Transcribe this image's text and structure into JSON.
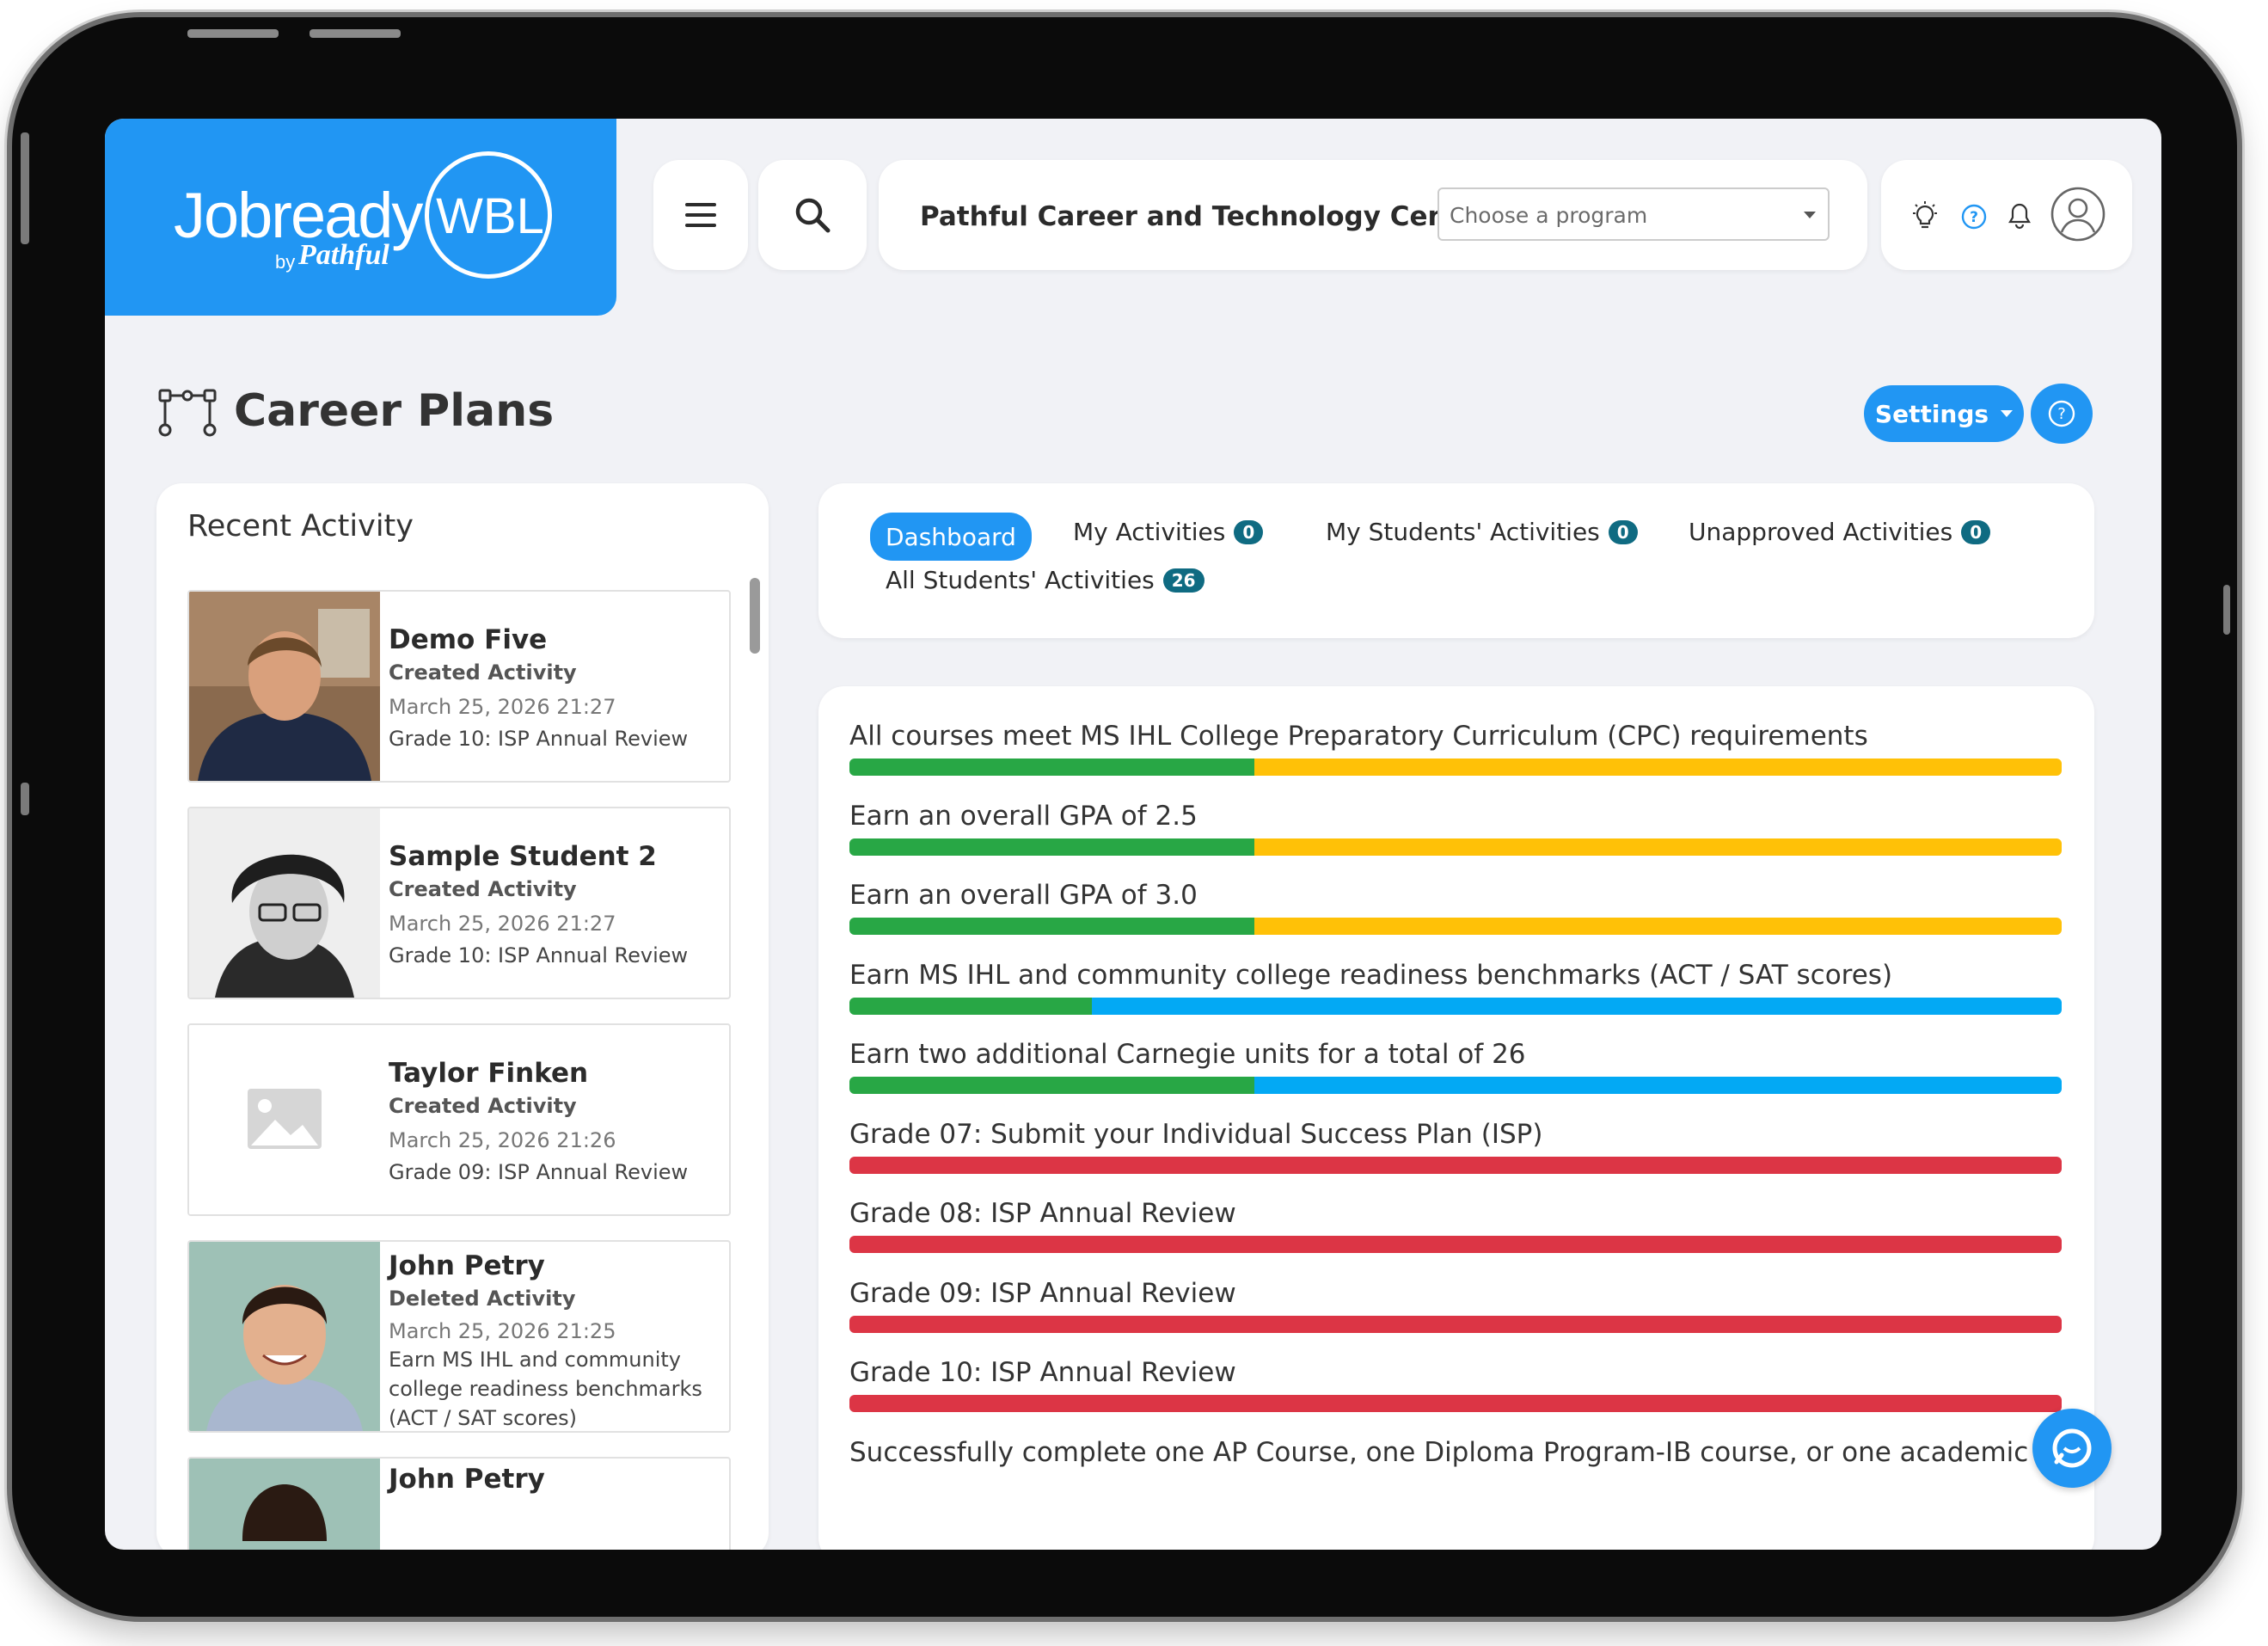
{
  "logo": {
    "word": "Jobready",
    "circle_text": "WBL",
    "by": "by",
    "brand": "Pathful"
  },
  "header": {
    "org_name": "Pathful Career and Technology Center",
    "program_placeholder": "Choose a program",
    "icons": [
      "menu-icon",
      "search-icon",
      "lightbulb-icon",
      "help-icon",
      "bell-icon",
      "user-avatar-icon"
    ]
  },
  "page": {
    "title": "Career Plans",
    "settings_label": "Settings"
  },
  "recent": {
    "title": "Recent Activity",
    "items": [
      {
        "name": "Demo Five",
        "action": "Created Activity",
        "date": "March 25, 2026 21:27",
        "desc": "Grade 10: ISP Annual Review",
        "photo": "student-photo"
      },
      {
        "name": "Sample Student 2",
        "action": "Created Activity",
        "date": "March 25, 2026 21:27",
        "desc": "Grade 10: ISP Annual Review",
        "photo": "student-photo"
      },
      {
        "name": "Taylor Finken",
        "action": "Created Activity",
        "date": "March 25, 2026 21:26",
        "desc": "Grade 09: ISP Annual Review",
        "photo": "placeholder-image-icon"
      },
      {
        "name": "John Petry",
        "action": "Deleted Activity",
        "date": "March 25, 2026 21:25",
        "desc": "Earn MS IHL and community college readiness benchmarks (ACT / SAT scores)",
        "photo": "student-photo"
      },
      {
        "name": "John Petry",
        "action": "",
        "date": "",
        "desc": "",
        "photo": "student-photo"
      }
    ]
  },
  "tabs": [
    {
      "label": "Dashboard",
      "count": null,
      "active": true
    },
    {
      "label": "My Activities",
      "count": "0"
    },
    {
      "label": "My Students' Activities",
      "count": "0"
    },
    {
      "label": "Unapproved Activities",
      "count": "0"
    },
    {
      "label": "All Students' Activities",
      "count": "26"
    }
  ],
  "colors": {
    "primary": "#2196f3",
    "green": "#28a745",
    "yellow": "#ffc107",
    "blue": "#03a9f4",
    "red": "#dc3545",
    "badge": "#0f6b82"
  },
  "goals": [
    {
      "label": "All courses meet MS IHL College Preparatory Curriculum (CPC) requirements",
      "segments": [
        {
          "color": "green",
          "fraction": 0.334
        },
        {
          "color": "yellow",
          "fraction": 0.666
        }
      ]
    },
    {
      "label": "Earn an overall GPA of 2.5",
      "segments": [
        {
          "color": "green",
          "fraction": 0.334
        },
        {
          "color": "yellow",
          "fraction": 0.666
        }
      ]
    },
    {
      "label": "Earn an overall GPA of 3.0",
      "segments": [
        {
          "color": "green",
          "fraction": 0.334
        },
        {
          "color": "yellow",
          "fraction": 0.666
        }
      ]
    },
    {
      "label": "Earn MS IHL and community college readiness benchmarks (ACT / SAT scores)",
      "segments": [
        {
          "color": "green",
          "fraction": 0.2
        },
        {
          "color": "blue",
          "fraction": 0.8
        }
      ]
    },
    {
      "label": "Earn two additional Carnegie units for a total of 26",
      "segments": [
        {
          "color": "green",
          "fraction": 0.334
        },
        {
          "color": "blue",
          "fraction": 0.666
        }
      ]
    },
    {
      "label": "Grade 07: Submit your Individual Success Plan (ISP)",
      "segments": [
        {
          "color": "red",
          "fraction": 1.0
        }
      ]
    },
    {
      "label": "Grade 08: ISP Annual Review",
      "segments": [
        {
          "color": "red",
          "fraction": 1.0
        }
      ]
    },
    {
      "label": "Grade 09: ISP Annual Review",
      "segments": [
        {
          "color": "red",
          "fraction": 1.0
        }
      ]
    },
    {
      "label": "Grade 10: ISP Annual Review",
      "segments": [
        {
          "color": "red",
          "fraction": 1.0
        }
      ]
    },
    {
      "label": "Successfully complete one AP Course, one Diploma Program-IB course, or one academic dual credit",
      "segments": []
    }
  ]
}
